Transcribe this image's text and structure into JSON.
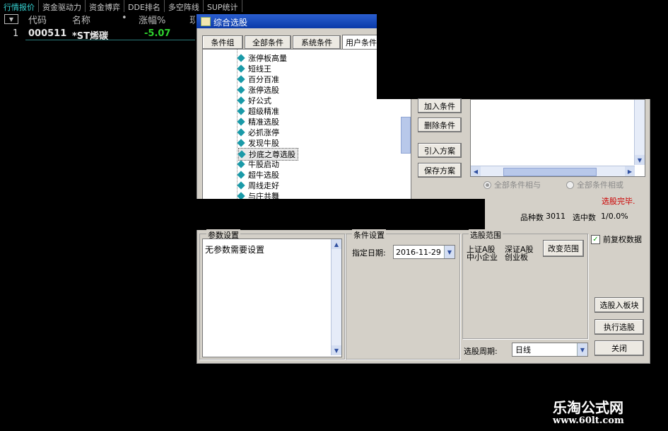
{
  "top_tabs": [
    "行情报价",
    "资金驱动力",
    "资金博弈",
    "DDE排名",
    "多空阵线",
    "SUP统计"
  ],
  "stock_table": {
    "headers": [
      "代码",
      "名称",
      "•",
      "涨幅%",
      "现"
    ],
    "row": {
      "index": "1",
      "code": "000511",
      "name": "*ST烯碳",
      "change": "-5.07"
    }
  },
  "dialog": {
    "title": "综合选股",
    "tabs": [
      "条件组",
      "全部条件",
      "系统条件",
      "用户条件"
    ],
    "tree_items": [
      "涨停板高量",
      "短线王",
      "百分百准",
      "涨停选股",
      "好公式",
      "超级精准",
      "精准选股",
      "必抓涨停",
      "发现牛股",
      "抄底之尊选股",
      "牛股启动",
      "超牛选股",
      "周线走好",
      "与庄共舞"
    ],
    "selected_tree_item": "抄底之尊选股",
    "buttons": {
      "add": "加入条件",
      "delete": "删除条件",
      "import": "引入方案",
      "save": "保存方案"
    },
    "radio_and": "全部条件相与",
    "radio_or": "全部条件相或",
    "status": "选股完毕.",
    "count_label": "品种数",
    "count_value": "3011",
    "selected_label": "选中数",
    "selected_value": "1/0.0%",
    "param_group": {
      "title": "参数设置",
      "text": "无参数需要设置"
    },
    "cond_group": {
      "title": "条件设置",
      "date_label": "指定日期:",
      "date_value": "2016-11-29"
    },
    "range_group": {
      "title": "选股范围",
      "items": [
        "上证A股",
        "深证A股",
        "中小企业",
        "创业板"
      ],
      "change_button": "改变范围"
    },
    "fuquan_label": "前复权数据",
    "to_block": "选股入板块",
    "execute": "执行选股",
    "close": "关闭",
    "period_label": "选股周期:",
    "period_value": "日线"
  },
  "watermark": {
    "title": "乐淘公式网",
    "url": "www.60lt.com"
  },
  "colors": {
    "accent_cyan": "#38d8d8",
    "down_green": "#2ed22e",
    "status_red": "#cc0000"
  }
}
